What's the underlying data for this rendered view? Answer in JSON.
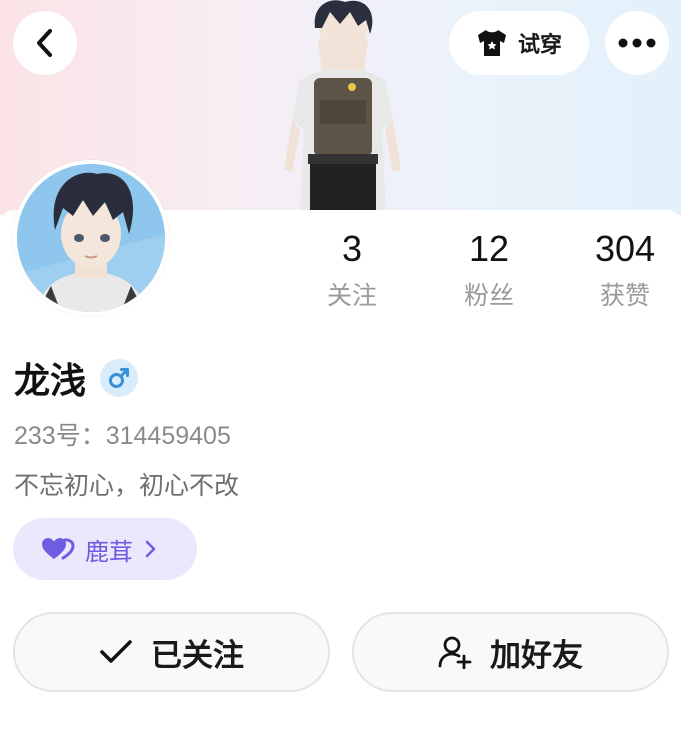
{
  "header": {
    "tryon_label": "试穿"
  },
  "stats": [
    {
      "value": "3",
      "label": "关注"
    },
    {
      "value": "12",
      "label": "粉丝"
    },
    {
      "value": "304",
      "label": "获赞"
    }
  ],
  "profile": {
    "name": "龙浅",
    "gender_symbol": "♂",
    "uid": "233号：314459405",
    "signature": "不忘初心，初心不改",
    "tag_label": "鹿茸"
  },
  "actions": {
    "followed_label": "已关注",
    "add_friend_label": "加好友"
  },
  "colors": {
    "accent_purple": "#6e5de0",
    "gender_blue": "#3a8fd9"
  }
}
